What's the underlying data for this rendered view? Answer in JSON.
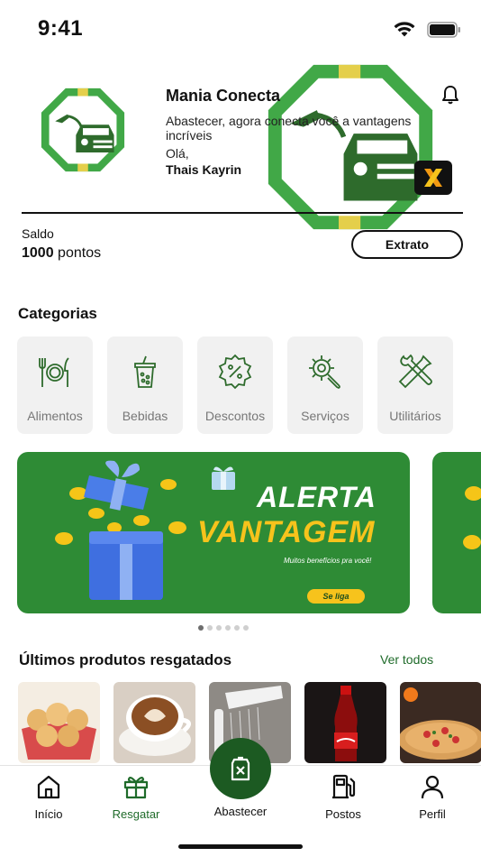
{
  "status_bar": {
    "time": "9:41"
  },
  "header": {
    "brand": "Mania Conecta",
    "tagline": "Abastecer, agora conecta você a vantagens incríveis",
    "greeting": "Olá,",
    "user_name": "Thais Kayrin"
  },
  "balance": {
    "label": "Saldo",
    "value": "1000",
    "unit": "pontos",
    "statement_label": "Extrato"
  },
  "categories": {
    "title": "Categorias",
    "items": [
      {
        "label": "Alimentos",
        "icon": "cutlery-icon"
      },
      {
        "label": "Bebidas",
        "icon": "drink-cup-icon"
      },
      {
        "label": "Descontos",
        "icon": "discount-badge-icon"
      },
      {
        "label": "Serviços",
        "icon": "gear-wrench-icon"
      },
      {
        "label": "Utilitários",
        "icon": "tools-icon"
      }
    ]
  },
  "banner": {
    "title_line1": "ALERTA",
    "title_line2": "VANTAGEM",
    "subtitle": "Muitos benefícios pra você!",
    "cta": "Se liga",
    "pages": 6,
    "active_page": 1
  },
  "recent": {
    "title": "Últimos produtos resgatados",
    "see_all": "Ver todos",
    "products": [
      "cheese-bread",
      "cappuccino",
      "shower-head",
      "coca-cola",
      "pizza"
    ]
  },
  "nav": {
    "items": [
      {
        "label": "Início",
        "icon": "home-icon"
      },
      {
        "label": "Resgatar",
        "icon": "gift-icon",
        "active": true
      },
      {
        "label": "Abastecer",
        "icon": "fuel-can-icon"
      },
      {
        "label": "Postos",
        "icon": "gas-station-icon"
      },
      {
        "label": "Perfil",
        "icon": "user-icon"
      }
    ]
  },
  "colors": {
    "brand_green": "#2e8b35",
    "dark_green": "#1c5a22",
    "accent_yellow": "#f7c31c"
  }
}
